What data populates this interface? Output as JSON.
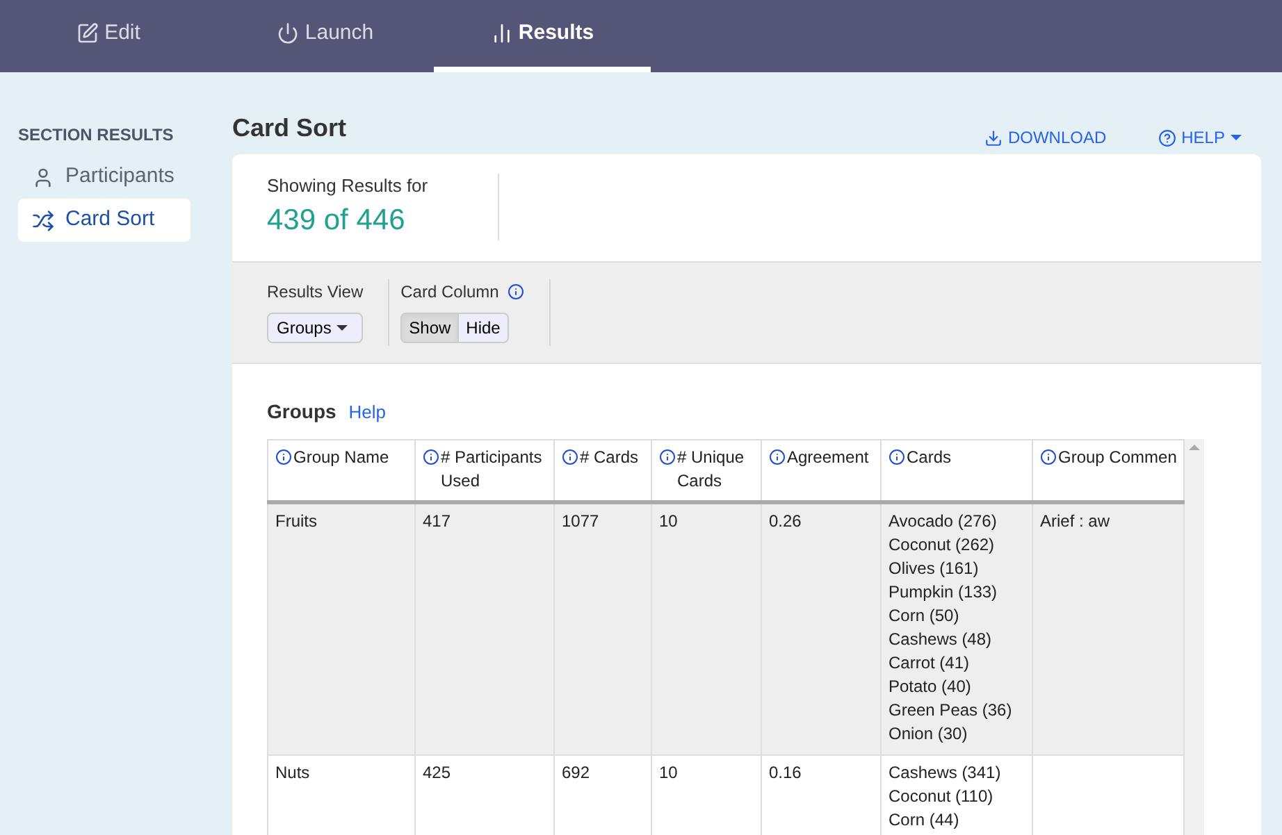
{
  "tabs": [
    {
      "label": "Edit",
      "selected": false
    },
    {
      "label": "Launch",
      "selected": false
    },
    {
      "label": "Results",
      "selected": true
    }
  ],
  "sidebar": {
    "heading": "SECTION RESULTS",
    "items": [
      {
        "label": "Participants",
        "selected": false
      },
      {
        "label": "Card Sort",
        "selected": true
      }
    ]
  },
  "page_title": "Card Sort",
  "actions": {
    "download": "DOWNLOAD",
    "help": "HELP"
  },
  "summary": {
    "label": "Showing Results for",
    "value": "439 of 446"
  },
  "filters": {
    "results_view": {
      "label": "Results View",
      "value": "Groups"
    },
    "card_column": {
      "label": "Card Column",
      "options": [
        {
          "label": "Show",
          "selected": true
        },
        {
          "label": "Hide",
          "selected": false
        }
      ]
    }
  },
  "groups": {
    "title": "Groups",
    "help_link": "Help",
    "table": {
      "columns": [
        "Group Name",
        "# Participants Used",
        "# Cards",
        "# Unique Cards",
        "Agreement",
        "Cards",
        "Group Commen"
      ],
      "rows": [
        {
          "selected": true,
          "cells": [
            "Fruits",
            "417",
            "1077",
            "10",
            "0.26"
          ],
          "cards": [
            "Avocado (276)",
            "Coconut (262)",
            "Olives (161)",
            "Pumpkin (133)",
            "Corn (50)",
            "Cashews (48)",
            "Carrot (41)",
            "Potato (40)",
            "Green Peas (36)",
            "Onion (30)"
          ],
          "comment": "Arief : aw"
        },
        {
          "selected": false,
          "cells": [
            "Nuts",
            "425",
            "692",
            "10",
            "0.16"
          ],
          "cards": [
            "Cashews (341)",
            "Coconut (110)",
            "Corn (44)"
          ]
        }
      ]
    }
  }
}
